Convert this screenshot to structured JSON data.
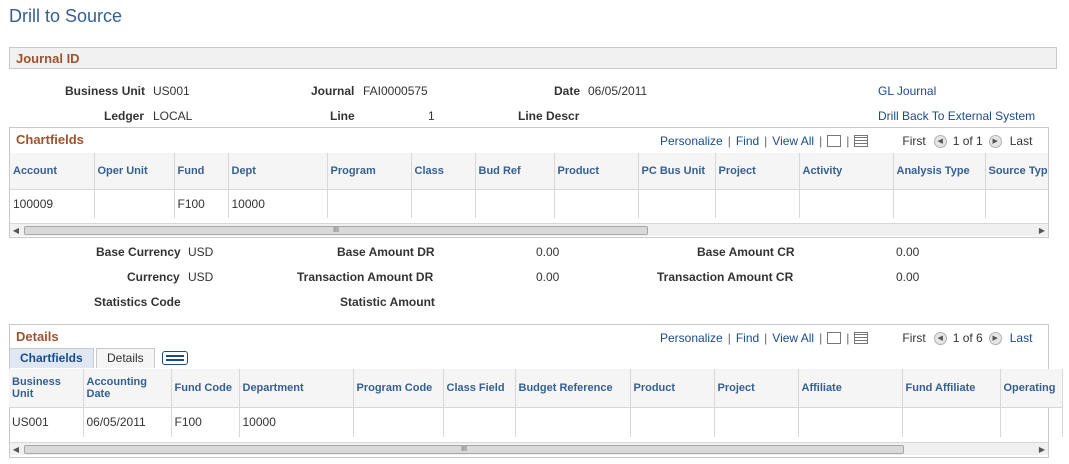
{
  "page_title": "Drill to Source",
  "journal_section": {
    "title": "Journal ID",
    "business_unit_label": "Business Unit",
    "business_unit": "US001",
    "journal_label": "Journal",
    "journal": "FAI0000575",
    "date_label": "Date",
    "date": "06/05/2011",
    "gl_journal_link": "GL Journal",
    "ledger_label": "Ledger",
    "ledger": "LOCAL",
    "line_label": "Line",
    "line": "1",
    "line_descr_label": "Line Descr",
    "drill_back_link": "Drill Back To External System"
  },
  "chartfields_grid": {
    "title": "Chartfields",
    "personalize": "Personalize",
    "find": "Find",
    "view_all": "View All",
    "first": "First",
    "range": "1 of 1",
    "last": "Last",
    "columns": [
      "Account",
      "Oper Unit",
      "Fund",
      "Dept",
      "Program",
      "Class",
      "Bud Ref",
      "Product",
      "PC Bus Unit",
      "Project",
      "Activity",
      "Analysis Type",
      "Source Type"
    ],
    "rows": [
      [
        "100009",
        "",
        "F100",
        "10000",
        "",
        "",
        "",
        "",
        "",
        "",
        "",
        "",
        ""
      ]
    ],
    "scroll_grip": "III"
  },
  "amounts": {
    "base_currency_label": "Base Currency",
    "base_currency": "USD",
    "base_amount_dr_label": "Base Amount DR",
    "base_amount_dr": "0.00",
    "base_amount_cr_label": "Base Amount CR",
    "base_amount_cr": "0.00",
    "currency_label": "Currency",
    "currency": "USD",
    "transaction_amount_dr_label": "Transaction Amount DR",
    "transaction_amount_dr": "0.00",
    "transaction_amount_cr_label": "Transaction Amount CR",
    "transaction_amount_cr": "0.00",
    "statistics_code_label": "Statistics Code",
    "statistic_amount_label": "Statistic Amount"
  },
  "details_grid": {
    "title": "Details",
    "personalize": "Personalize",
    "find": "Find",
    "view_all": "View All",
    "first": "First",
    "range": "1 of 6",
    "last": "Last",
    "tabs": [
      "Chartfields",
      "Details"
    ],
    "columns": [
      "Business Unit",
      "Accounting Date",
      "Fund Code",
      "Department",
      "Program Code",
      "Class Field",
      "Budget Reference",
      "Product",
      "Project",
      "Affiliate",
      "Fund Affiliate",
      "Operating"
    ],
    "rows": [
      [
        "US001",
        "06/05/2011",
        "F100",
        "10000",
        "",
        "",
        "",
        "",
        "",
        "",
        "",
        ""
      ]
    ],
    "scroll_grip": "III"
  },
  "colors": {
    "title_blue": "#365f91",
    "section_brown": "#a0522d",
    "link_blue": "#1b4a8a"
  },
  "icons": [
    "zoom-icon",
    "download-grid-icon",
    "first-arrow-icon",
    "last-arrow-icon",
    "show-all-columns-icon"
  ]
}
